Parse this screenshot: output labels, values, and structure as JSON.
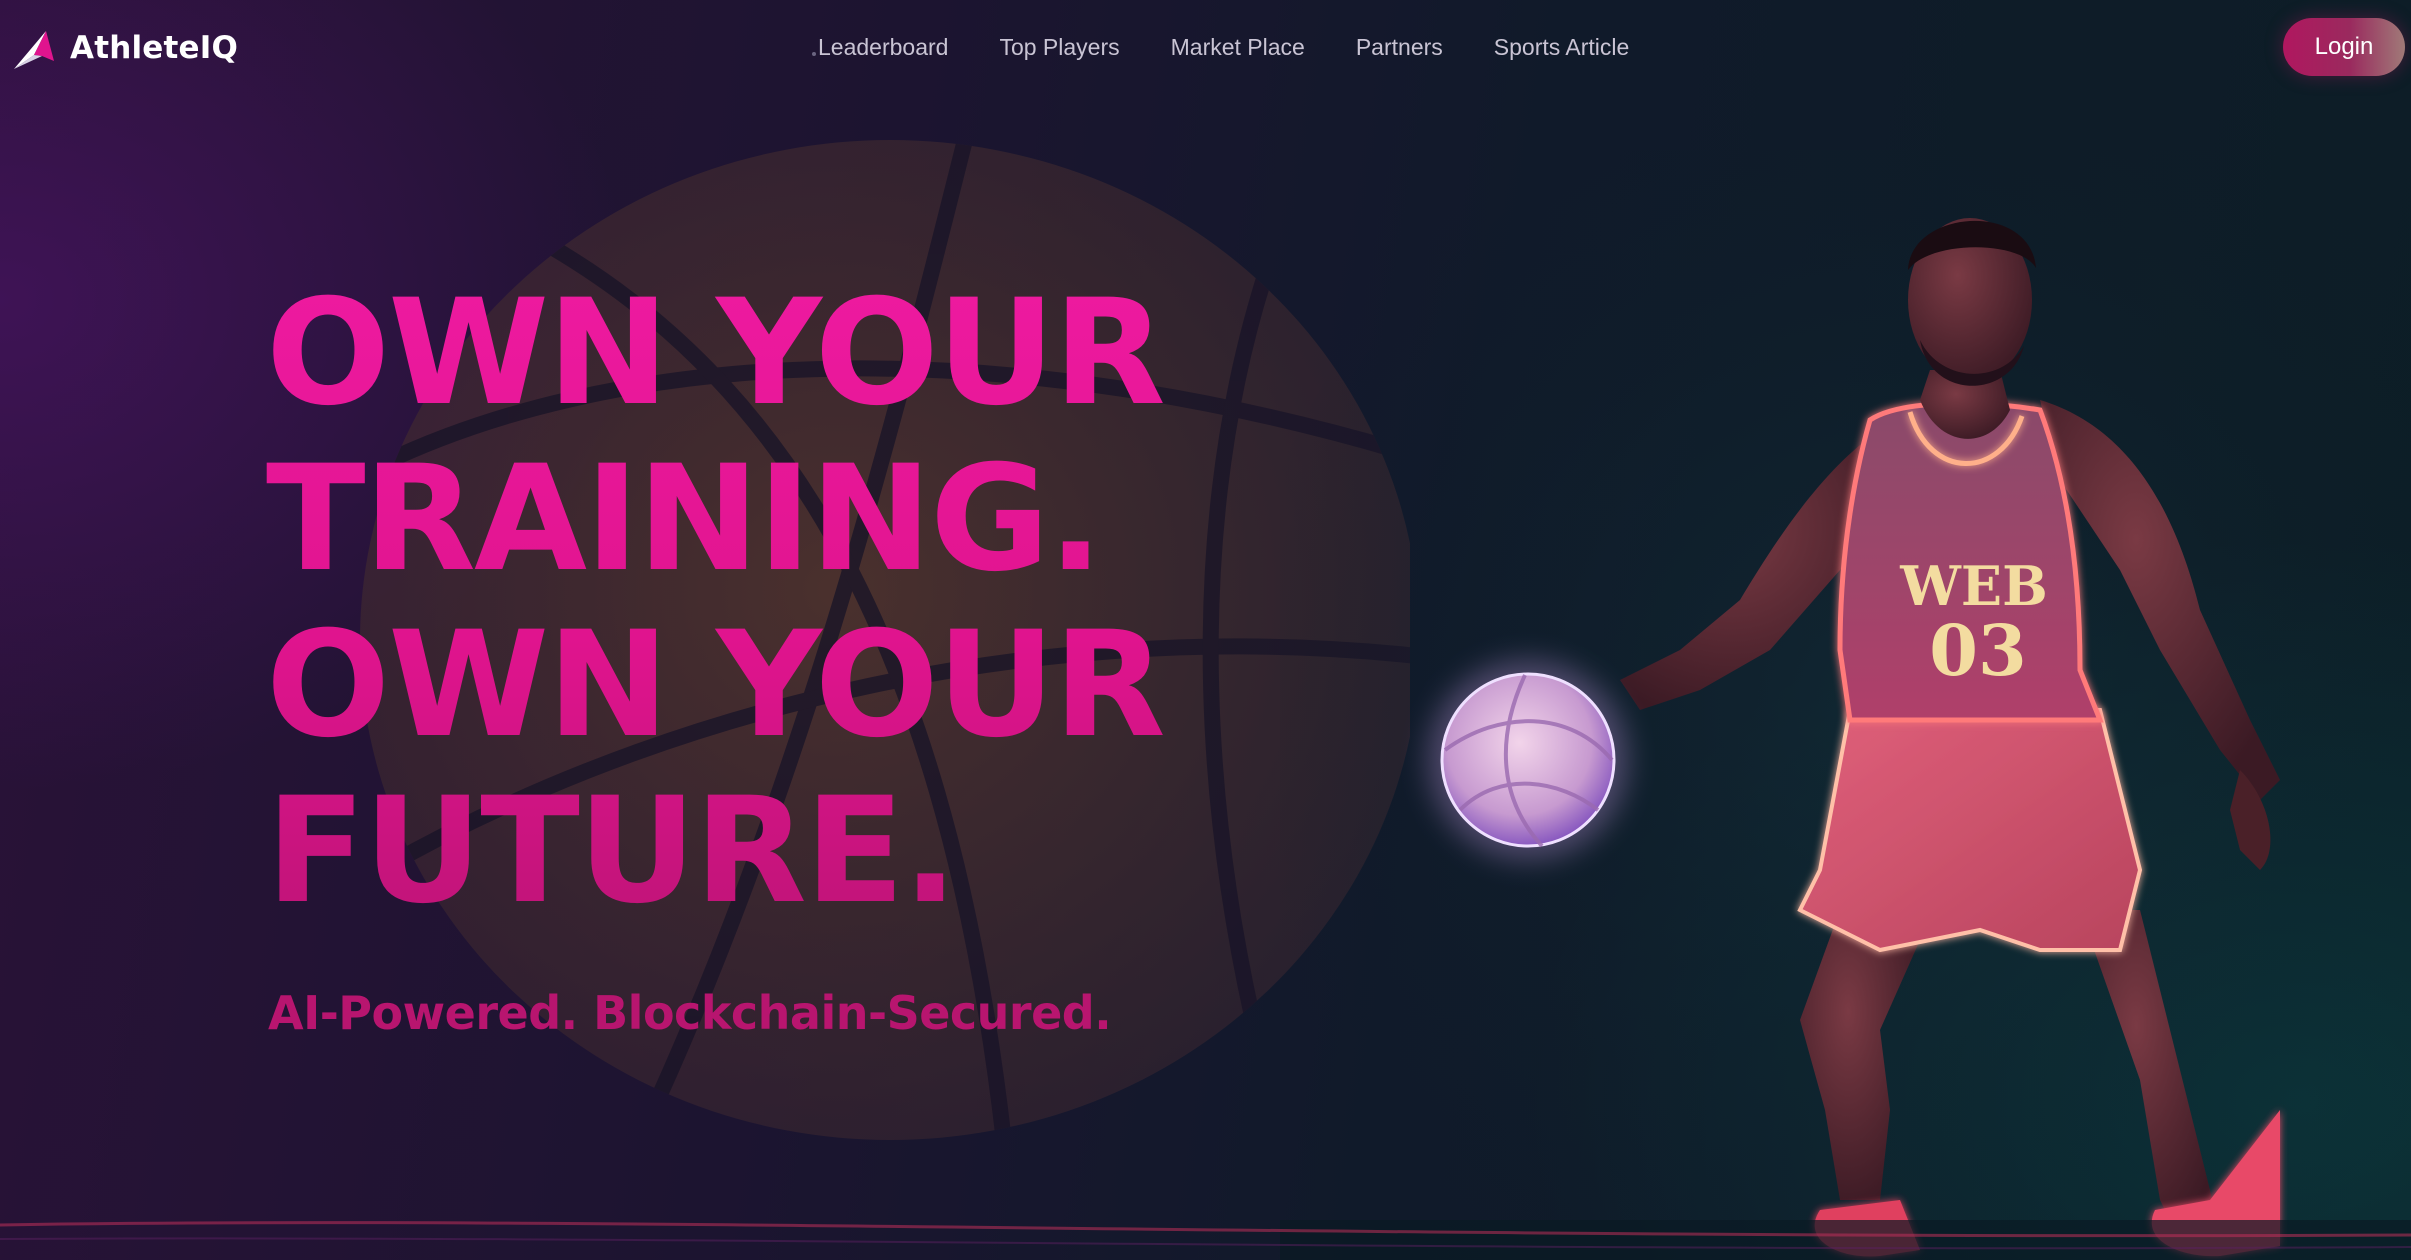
{
  "brand": {
    "name": "AthleteIQ",
    "logo_icon": "athleteiq-logo-icon"
  },
  "nav": {
    "items": [
      {
        "label": "Leaderboard"
      },
      {
        "label": "Top Players"
      },
      {
        "label": "Market Place"
      },
      {
        "label": "Partners"
      },
      {
        "label": "Sports Article"
      }
    ]
  },
  "header": {
    "login_label": "Login"
  },
  "hero": {
    "headline_lines": [
      "OWN YOUR",
      "TRAINING.",
      "OWN YOUR",
      "FUTURE."
    ],
    "subtitle": "AI-Powered. Blockchain-Secured.",
    "jersey": {
      "top": "WEB",
      "number": "03"
    }
  },
  "colors": {
    "accent_pink": "#e0148e",
    "subtitle_pink": "#b8156f",
    "login_gradient_start": "#b0175f",
    "login_gradient_end": "#a07a78",
    "nav_text": "#c9c4d4",
    "background_purple": "#2a1238",
    "background_teal": "#0c1e26",
    "neon_red": "#ff3c6a",
    "jersey_text": "#f3dca0"
  }
}
